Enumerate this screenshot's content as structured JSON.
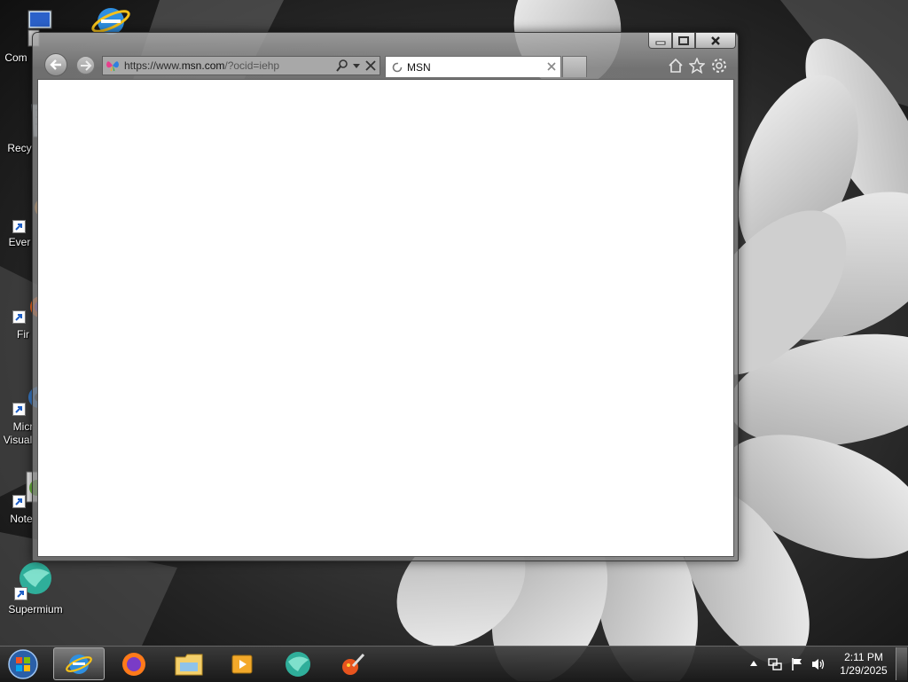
{
  "desktop": {
    "icons": [
      {
        "label": "Com",
        "icon": "computer-icon"
      },
      {
        "label": "Recy",
        "icon": "recycle-bin-icon"
      },
      {
        "label": "Ever",
        "icon": "everything-icon"
      },
      {
        "label": "Fir",
        "icon": "firefox-icon"
      },
      {
        "label": "Micr",
        "label2": "Visual",
        "icon": "visual-studio-icon"
      },
      {
        "label": "Note",
        "icon": "notepad-icon"
      },
      {
        "label": "Supermium",
        "icon": "supermium-icon"
      },
      {
        "label": "",
        "icon": "internet-explorer-icon"
      }
    ]
  },
  "browser": {
    "address": {
      "scheme": "https://www.",
      "host": "msn.com",
      "path": "/?ocid=iehp",
      "favicon": "msn-butterfly-icon"
    },
    "tabs": [
      {
        "title": "MSN",
        "loading": true
      }
    ],
    "toolbar_icons": [
      "home-icon",
      "favorites-star-icon",
      "tools-gear-icon"
    ],
    "caption_buttons": [
      "minimize",
      "maximize",
      "close"
    ]
  },
  "taskbar": {
    "items": [
      {
        "name": "internet-explorer",
        "active": true
      },
      {
        "name": "firefox",
        "active": false
      },
      {
        "name": "windows-explorer",
        "active": false
      },
      {
        "name": "media-player",
        "active": false
      },
      {
        "name": "supermium",
        "active": false
      },
      {
        "name": "paint",
        "active": false
      }
    ],
    "clock": {
      "time": "2:11 PM",
      "date": "1/29/2025"
    }
  },
  "colors": {
    "window_chrome": "#9a9a9a",
    "content_bg": "#ffffff",
    "taskbar": "#2a2a2a"
  }
}
